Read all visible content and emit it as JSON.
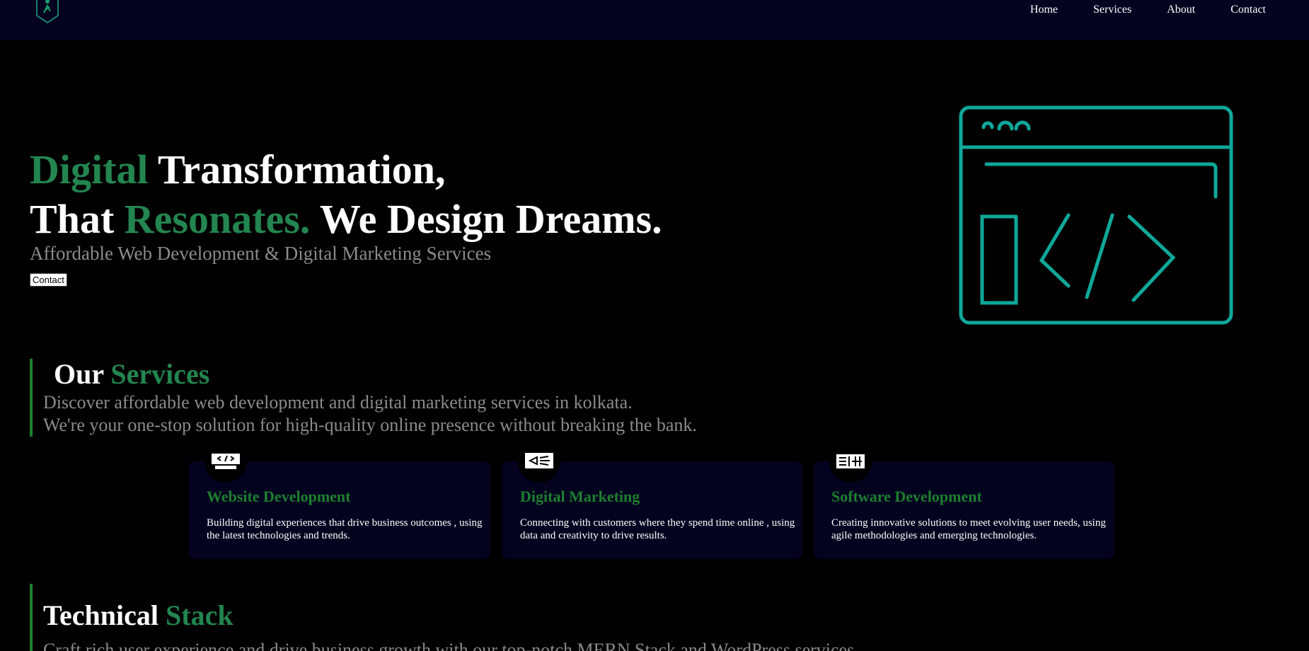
{
  "nav": {
    "items": [
      "Home",
      "Services",
      "About",
      "Contact"
    ]
  },
  "hero": {
    "line1_green": "Digital",
    "line1_white": " Transformation,",
    "line2_white1": "That ",
    "line2_green": "Resonates.",
    "line2_white2": " We Design Dreams.",
    "subtitle": "Affordable Web Development & Digital Marketing Services",
    "button": "Contact"
  },
  "services": {
    "title_white": "Our ",
    "title_green": "Services",
    "desc_line1": "Discover affordable web development and digital marketing services in kolkata.",
    "desc_line2": "We're your one-stop solution for high-quality online presence without breaking the bank.",
    "cards": [
      {
        "icon": "web-code-icon",
        "title": "Website Development",
        "desc": "Building digital experiences that drive business outcomes , using the latest technologies and trends."
      },
      {
        "icon": "megaphone-icon",
        "title": "Digital Marketing",
        "desc": "Connecting with customers where they spend time online , using data and creativity to drive results."
      },
      {
        "icon": "software-grid-icon",
        "title": "Software Development",
        "desc": "Creating innovative solutions to meet evolving user needs, using agile methodologies and emerging technologies."
      }
    ]
  },
  "tech": {
    "title_white": "Technical ",
    "title_green": "Stack",
    "desc": "Craft rich user experience and drive business growth with our top-notch MERN Stack and WordPress services."
  },
  "colors": {
    "nav_bg": "#03031f",
    "accent_green": "#23854f",
    "card_title_green": "#1d7f2e",
    "illustration_teal": "#0fa89a"
  }
}
